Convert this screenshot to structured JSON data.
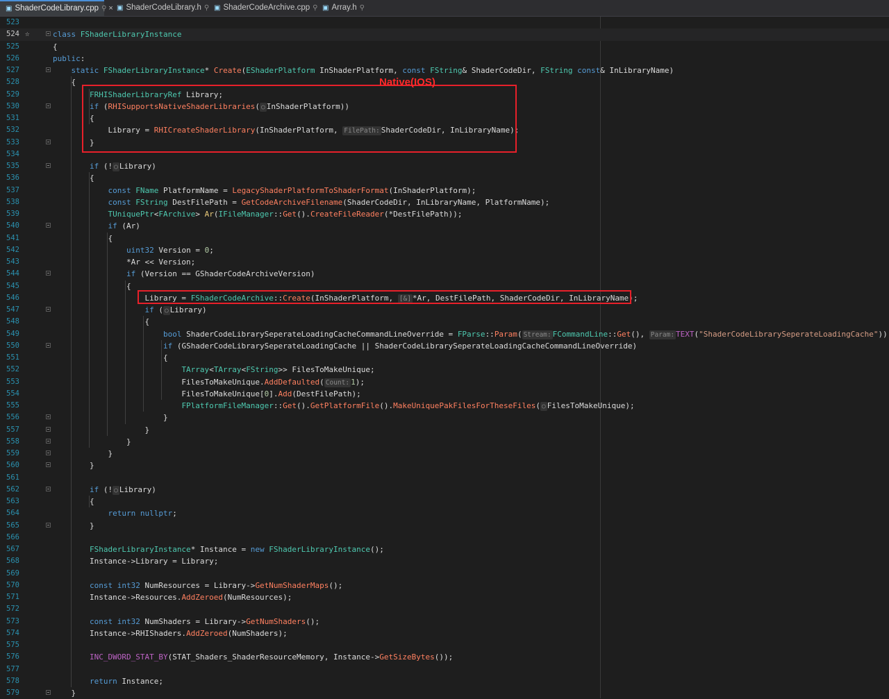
{
  "tabs": [
    {
      "label": "ShaderCodeLibrary.cpp",
      "active": true
    },
    {
      "label": "ShaderCodeLibrary.h",
      "active": false
    },
    {
      "label": "ShaderCodeArchive.cpp",
      "active": false
    },
    {
      "label": "Array.h",
      "active": false
    }
  ],
  "annotation": "Native(IOS)",
  "colors": {
    "annotation": "#ff2a2a",
    "line_numbers": "#2b91af",
    "keyword": "#569cd6",
    "type": "#4ec9b0"
  },
  "lines": [
    {
      "n": "523",
      "html": ""
    },
    {
      "n": "524",
      "html": "<span class='t-kw'>class</span> <span class='t-ty'>FShaderLibraryInstance</span>"
    },
    {
      "n": "525",
      "html": "{"
    },
    {
      "n": "526",
      "html": "<span class='t-kw'>public</span>:"
    },
    {
      "n": "527",
      "html": "    <span class='t-kw'>static</span> <span class='t-ty'>FShaderLibraryInstance</span>* <span class='t-fn'>Create</span>(<span class='t-ty'>EShaderPlatform</span> InShaderPlatform, <span class='t-kw'>const</span> <span class='t-ty'>FString</span>&amp; ShaderCodeDir, <span class='t-ty'>FString</span> <span class='t-kw'>const</span>&amp; InLibraryName)"
    },
    {
      "n": "528",
      "html": "    {"
    },
    {
      "n": "529",
      "html": "        <span class='t-ty'>FRHIShaderLibraryRef</span> Library;"
    },
    {
      "n": "530",
      "html": "        <span class='t-kw'>if</span> (<span class='t-fn'>RHISupportsNativeShaderLibraries</span>(<span class='hint'>&#9675;</span>InShaderPlatform))"
    },
    {
      "n": "531",
      "html": "        {"
    },
    {
      "n": "532",
      "html": "            Library = <span class='t-fn'>RHICreateShaderLibrary</span>(InShaderPlatform, <span class='hint'>FilePath:</span>ShaderCodeDir, InLibraryName);"
    },
    {
      "n": "533",
      "html": "        }"
    },
    {
      "n": "534",
      "html": ""
    },
    {
      "n": "535",
      "html": "        <span class='t-kw'>if</span> (!<span class='hint'>&#9675;</span>Library)"
    },
    {
      "n": "536",
      "html": "        {"
    },
    {
      "n": "537",
      "html": "            <span class='t-kw'>const</span> <span class='t-ty'>FName</span> PlatformName = <span class='t-fn'>LegacyShaderPlatformToShaderFormat</span>(InShaderPlatform);"
    },
    {
      "n": "538",
      "html": "            <span class='t-kw'>const</span> <span class='t-ty'>FString</span> DestFilePath = <span class='t-fn'>GetCodeArchiveFilename</span>(ShaderCodeDir, InLibraryName, PlatformName);"
    },
    {
      "n": "539",
      "html": "            <span class='t-ty'>TUniquePtr</span>&lt;<span class='t-ty'>FArchive</span>&gt; <span class='t-st'>Ar</span>(<span class='t-ty'>IFileManager</span>::<span class='t-fn'>Get</span>().<span class='t-fn'>CreateFileReader</span>(*DestFilePath));"
    },
    {
      "n": "540",
      "html": "            <span class='t-kw'>if</span> (Ar)"
    },
    {
      "n": "541",
      "html": "            {"
    },
    {
      "n": "542",
      "html": "                <span class='t-kw'>uint32</span> Version = <span class='t-nm'>0</span>;"
    },
    {
      "n": "543",
      "html": "                *Ar &lt;&lt; Version;"
    },
    {
      "n": "544",
      "html": "                <span class='t-kw'>if</span> (Version == GShaderCodeArchiveVersion)"
    },
    {
      "n": "545",
      "html": "                {"
    },
    {
      "n": "546",
      "html": "                    Library = <span class='t-ty'>FShaderCodeArchive</span>::<span class='t-fn'>Create</span>(InShaderPlatform, <span class='hint'>[&amp;]</span>*Ar, DestFilePath, ShaderCodeDir, InLibraryName);"
    },
    {
      "n": "547",
      "html": "                    <span class='t-kw'>if</span> (<span class='hint'>&#9675;</span>Library)"
    },
    {
      "n": "548",
      "html": "                    {"
    },
    {
      "n": "549",
      "html": "                        <span class='t-kw'>bool</span> ShaderCodeLibrarySeperateLoadingCacheCommandLineOverride = <span class='t-ty'>FParse</span>::<span class='t-fn'>Param</span>(<span class='hint'>Stream:</span><span class='t-ty'>FCommandLine</span>::<span class='t-fn'>Get</span>(), <span class='hint'>Param:</span><span class='t-mac'>TEXT</span>(<span class='t-str'>\"ShaderCodeLibrarySeperateLoadingCache\"</span>));"
    },
    {
      "n": "550",
      "html": "                        <span class='t-kw'>if</span> (GShaderCodeLibrarySeperateLoadingCache || ShaderCodeLibrarySeperateLoadingCacheCommandLineOverride)"
    },
    {
      "n": "551",
      "html": "                        {"
    },
    {
      "n": "552",
      "html": "                            <span class='t-ty'>TArray</span>&lt;<span class='t-ty'>TArray</span>&lt;<span class='t-ty'>FString</span>&gt;&gt; FilesToMakeUnique;"
    },
    {
      "n": "553",
      "html": "                            FilesToMakeUnique.<span class='t-fn'>AddDefaulted</span>(<span class='hint'>Count:</span><span class='t-nm'>1</span>);"
    },
    {
      "n": "554",
      "html": "                            FilesToMakeUnique[<span class='t-nm'>0</span>].<span class='t-fn'>Add</span>(DestFilePath);"
    },
    {
      "n": "555",
      "html": "                            <span class='t-ty'>FPlatformFileManager</span>::<span class='t-fn'>Get</span>().<span class='t-fn'>GetPlatformFile</span>().<span class='t-fn'>MakeUniquePakFilesForTheseFiles</span>(<span class='hint'>&#9675;</span>FilesToMakeUnique);"
    },
    {
      "n": "556",
      "html": "                        }"
    },
    {
      "n": "557",
      "html": "                    }"
    },
    {
      "n": "558",
      "html": "                }"
    },
    {
      "n": "559",
      "html": "            }"
    },
    {
      "n": "560",
      "html": "        }"
    },
    {
      "n": "561",
      "html": ""
    },
    {
      "n": "562",
      "html": "        <span class='t-kw'>if</span> (!<span class='hint'>&#9675;</span>Library)"
    },
    {
      "n": "563",
      "html": "        {"
    },
    {
      "n": "564",
      "html": "            <span class='t-kw'>return</span> <span class='t-kw'>nullptr</span>;"
    },
    {
      "n": "565",
      "html": "        }"
    },
    {
      "n": "566",
      "html": ""
    },
    {
      "n": "567",
      "html": "        <span class='t-ty'>FShaderLibraryInstance</span>* Instance = <span class='t-kw'>new</span> <span class='t-ty'>FShaderLibraryInstance</span>();"
    },
    {
      "n": "568",
      "html": "        Instance-&gt;Library = Library;"
    },
    {
      "n": "569",
      "html": ""
    },
    {
      "n": "570",
      "html": "        <span class='t-kw'>const</span> <span class='t-kw'>int32</span> NumResources = Library-&gt;<span class='t-fn'>GetNumShaderMaps</span>();"
    },
    {
      "n": "571",
      "html": "        Instance-&gt;Resources.<span class='t-fn'>AddZeroed</span>(NumResources);"
    },
    {
      "n": "572",
      "html": ""
    },
    {
      "n": "573",
      "html": "        <span class='t-kw'>const</span> <span class='t-kw'>int32</span> NumShaders = Library-&gt;<span class='t-fn'>GetNumShaders</span>();"
    },
    {
      "n": "574",
      "html": "        Instance-&gt;RHIShaders.<span class='t-fn'>AddZeroed</span>(NumShaders);"
    },
    {
      "n": "575",
      "html": ""
    },
    {
      "n": "576",
      "html": "        <span class='t-mac'>INC_DWORD_STAT_BY</span>(STAT_Shaders_ShaderResourceMemory, Instance-&gt;<span class='t-fn'>GetSizeBytes</span>());"
    },
    {
      "n": "577",
      "html": ""
    },
    {
      "n": "578",
      "html": "        <span class='t-kw'>return</span> Instance;"
    },
    {
      "n": "579",
      "html": "    }"
    }
  ]
}
